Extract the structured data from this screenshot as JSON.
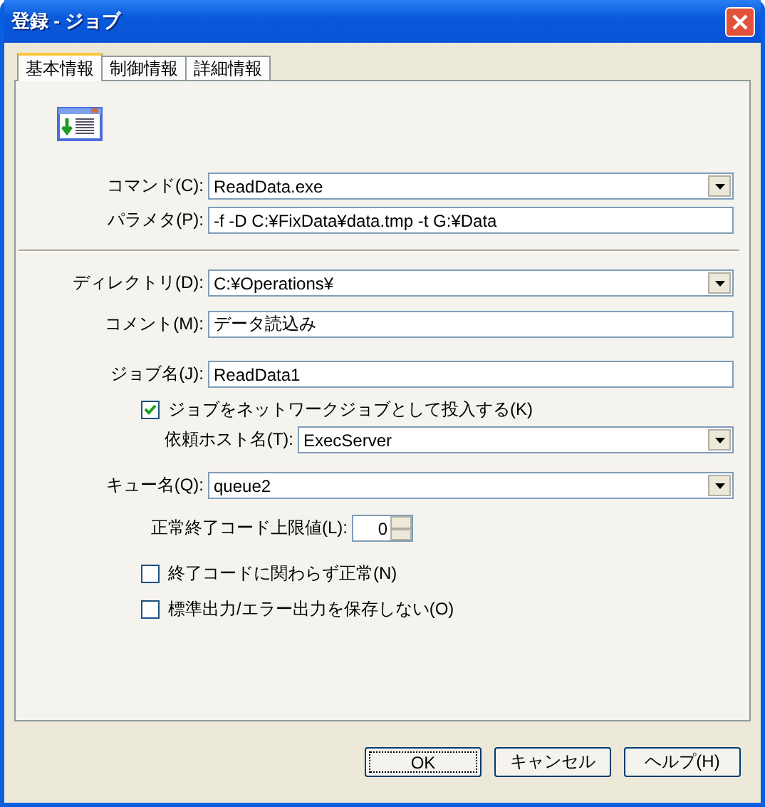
{
  "window": {
    "title": "登録 - ジョブ"
  },
  "tabs": [
    {
      "label": "基本情報",
      "selected": true
    },
    {
      "label": "制御情報",
      "selected": false
    },
    {
      "label": "詳細情報",
      "selected": false
    }
  ],
  "command": {
    "label": "コマンド(C):",
    "value": "ReadData.exe"
  },
  "parameter": {
    "label": "パラメタ(P):",
    "value": "-f -D C:¥FixData¥data.tmp -t G:¥Data"
  },
  "directory": {
    "label": "ディレクトリ(D):",
    "value": "C:¥Operations¥"
  },
  "comment": {
    "label": "コメント(M):",
    "value": "データ読込み"
  },
  "job_name": {
    "label": "ジョブ名(J):",
    "value": "ReadData1"
  },
  "network_job": {
    "label": "ジョブをネットワークジョブとして投入する(K)",
    "checked": true
  },
  "host": {
    "label": "依頼ホスト名(T):",
    "value": "ExecServer"
  },
  "queue": {
    "label": "キュー名(Q):",
    "value": "queue2"
  },
  "exit_code": {
    "label": "正常終了コード上限値(L):",
    "value": "0"
  },
  "options": [
    {
      "label": "終了コードに関わらず正常(N)",
      "checked": false
    },
    {
      "label": "標準出力/エラー出力を保存しない(O)",
      "checked": false
    }
  ],
  "buttons": [
    {
      "label": "OK",
      "focused": true
    },
    {
      "label": "キャンセル",
      "focused": false
    },
    {
      "label": "ヘルプ(H)",
      "focused": false
    }
  ]
}
